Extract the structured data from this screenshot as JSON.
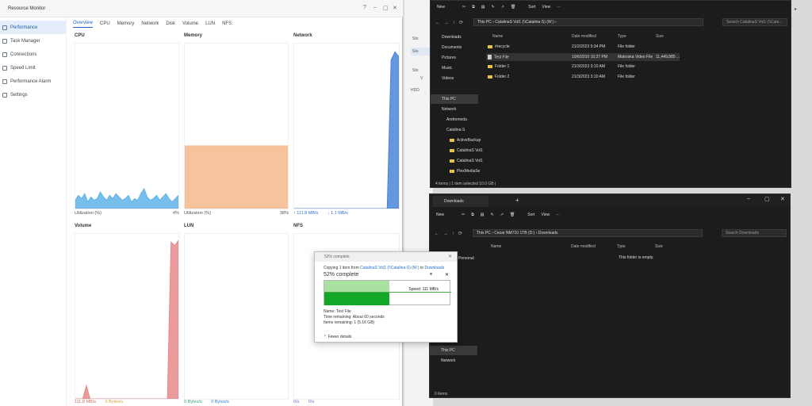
{
  "desktop": {
    "background": "#1c1c1c",
    "strip": "#a0a0a0"
  },
  "left_window": {
    "title": "Resource Monitor",
    "controls": [
      "?",
      "–",
      "▢",
      "✕"
    ]
  },
  "rm": {
    "sidebar": [
      {
        "label": "Performance",
        "active": true
      },
      {
        "label": "Task Manager"
      },
      {
        "label": "Connections"
      },
      {
        "label": "Speed Limit"
      },
      {
        "label": "Performance Alarm"
      },
      {
        "label": "Settings"
      }
    ],
    "tabs": [
      "Overview",
      "CPU",
      "Memory",
      "Network",
      "Disk",
      "Volume",
      "LUN",
      "NFS"
    ],
    "panels": {
      "cpu": {
        "title": "CPU",
        "foot_label": "Utilization (%)",
        "foot_value": "4%"
      },
      "memory": {
        "title": "Memory",
        "foot_label": "Utilization (%)",
        "foot_value": "38%"
      },
      "network": {
        "title": "Network",
        "up": "↑ 111.8 MB/s",
        "down": "↓ 1.1 MB/s"
      },
      "volume": {
        "title": "Volume",
        "read": "111.8 MB/s",
        "write": "0 Bytes/s"
      },
      "lun": {
        "title": "LUN",
        "read": "0 Bytes/s",
        "write": "0 Bytes/s"
      },
      "nfs": {
        "title": "NFS",
        "read": "0/s",
        "write": "0/s"
      }
    }
  },
  "chart_data": [
    {
      "type": "area",
      "title": "CPU",
      "ylabel": "Utilization (%)",
      "values": [
        5,
        8,
        6,
        9,
        4,
        7,
        5,
        6,
        10,
        7,
        5,
        8,
        6,
        9,
        7,
        5,
        6,
        8,
        4,
        6,
        5,
        9,
        12,
        7,
        5,
        6,
        8,
        5,
        7,
        9,
        6,
        4,
        6,
        8
      ],
      "color": "#5fb3e6"
    },
    {
      "type": "area",
      "title": "Memory",
      "ylabel": "Utilization (%)",
      "values": [
        38,
        38,
        38,
        38,
        38,
        38,
        38,
        38,
        38,
        38
      ],
      "color": "#f4b98c"
    },
    {
      "type": "area",
      "title": "Network",
      "values": [
        0,
        0,
        0,
        0,
        0,
        0,
        0,
        0,
        0,
        0,
        0,
        0,
        0,
        0,
        0,
        0,
        0,
        0,
        0,
        0,
        0,
        0,
        0,
        0,
        0,
        90,
        95,
        92
      ],
      "color": "#4a84d8"
    },
    {
      "type": "area",
      "title": "Volume",
      "values": [
        0,
        0,
        0,
        8,
        0,
        0,
        0,
        0,
        0,
        0,
        0,
        0,
        0,
        0,
        0,
        0,
        0,
        0,
        0,
        0,
        0,
        0,
        0,
        0,
        0,
        0,
        95,
        93,
        96
      ],
      "color": "#e88a8a"
    }
  ],
  "top_explorer": {
    "new": "New",
    "sort": "Sort",
    "view": "View",
    "address": "This PC  ›  CatalinaS Vol1 (\\\\Catalina-S) (W:)  ›",
    "search": "Search CatalinaS Vol1 (\\\\Cata...",
    "columns": [
      "Name",
      "Date modified",
      "Type",
      "Size"
    ],
    "nav": [
      "Downloads",
      "Documents",
      "Pictures",
      "Music",
      "Videos",
      "This PC",
      "Network",
      "Andromeda",
      "Catalina-S",
      "ActiveBackup",
      "CatalinaS Vol1",
      "CatalinaS Vol1",
      "PlexMediaSe"
    ],
    "files": [
      {
        "name": "#recycle",
        "date": "21/2/2023 5:34 PM",
        "type": "File folder",
        "size": ""
      },
      {
        "name": "Test File",
        "date": "10/6/2010 10:27 PM",
        "type": "Matroska Video File",
        "size": "11,449,885 ..."
      },
      {
        "name": "Folder 1",
        "date": "21/3/2023 3:10 AM",
        "type": "File folder",
        "size": ""
      },
      {
        "name": "Folder 2",
        "date": "21/3/2023 3:10 AM",
        "type": "File folder",
        "size": ""
      }
    ],
    "status": "4 items  |  1 item selected  10.0 GB  |"
  },
  "bottom_explorer": {
    "tab": "Downloads",
    "new": "New",
    "sort": "Sort",
    "view": "View",
    "address": "This PC  ›  Cezar NM710 1TB (D:)  ›  Downloads",
    "search": "Search Downloads",
    "columns": [
      "Name",
      "Date modified",
      "Type",
      "Size"
    ],
    "empty": "This folder is empty.",
    "nav": [
      "Personal",
      "This PC",
      "Network"
    ],
    "status": "0 items"
  },
  "copy": {
    "title": "52% complete",
    "line1_a": "Copying 1 item from ",
    "src": "CatalinaS Vol1 (\\\\Catalina-S) (W:)",
    "to": " to ",
    "dst": "Downloads",
    "big": "52% complete",
    "speed": "Speed: 111 MB/s",
    "name": "Name: Test File",
    "time": "Time remaining: About 60 seconds",
    "items": "Items remaining: 1 (5.16 GB)",
    "fewer": "Fewer details",
    "progress": 0.52
  },
  "left_strip": {
    "items": [
      "Sto",
      "Sto",
      "Sto",
      "V",
      "HDD"
    ]
  }
}
